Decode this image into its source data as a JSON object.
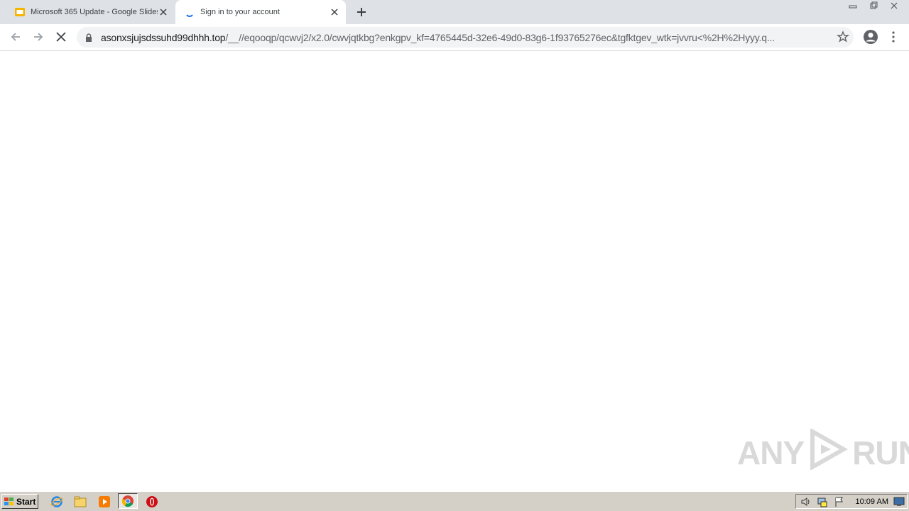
{
  "browser": {
    "tabs": [
      {
        "title": "Microsoft 365 Update - Google Slides",
        "favicon": "google-slides-icon",
        "active": false
      },
      {
        "title": "Sign in to your account",
        "favicon": "loading-spinner-icon",
        "active": true
      }
    ],
    "address": {
      "domain": "asonxsjujsdssuhd99dhhh.top",
      "path": "/__//eqooqp/qcwvj2/x2.0/cwvjqtkbg?enkgpv_kf=4765445d-32e6-49d0-83g6-1f93765276ec&tgfktgev_wtk=jvvru<%2H%2Hyyy.q..."
    }
  },
  "watermark": {
    "left": "ANY",
    "right": "RUN"
  },
  "taskbar": {
    "start_label": "Start",
    "clock": "10:09 AM"
  },
  "colors": {
    "tabstrip": "#dee1e6",
    "omnibox": "#f1f3f4",
    "taskbar": "#d4d0c8"
  }
}
